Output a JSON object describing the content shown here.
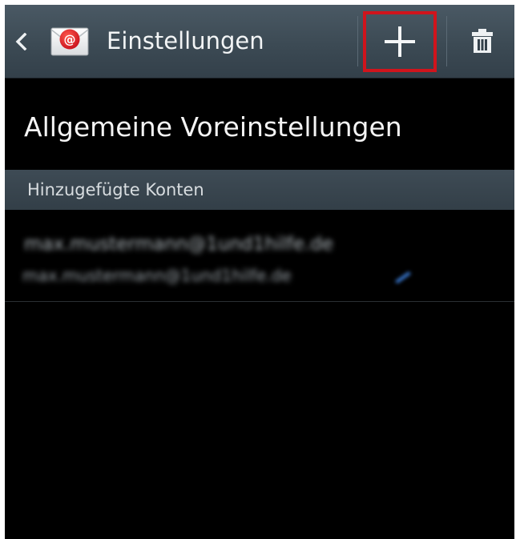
{
  "action_bar": {
    "title": "Einstellungen",
    "back_icon": "chevron-left-icon",
    "app_icon": "email-app-icon",
    "add_icon": "plus-icon",
    "delete_icon": "trash-icon",
    "highlight_color": "#d0141c"
  },
  "settings": {
    "general_preferences": "Allgemeine Voreinstellungen"
  },
  "accounts_section": {
    "header": "Hinzugefügte Konten",
    "accounts": [
      {
        "primary": "max.mustermann@1und1hilfe.de",
        "secondary": "max.mustermann@1und1hilfe.de",
        "status_icon": "sync-icon"
      }
    ]
  },
  "colors": {
    "background": "#000000",
    "action_bar": "#3c4a54",
    "section_header": "#38444d",
    "text_primary": "#f4f4f4"
  }
}
